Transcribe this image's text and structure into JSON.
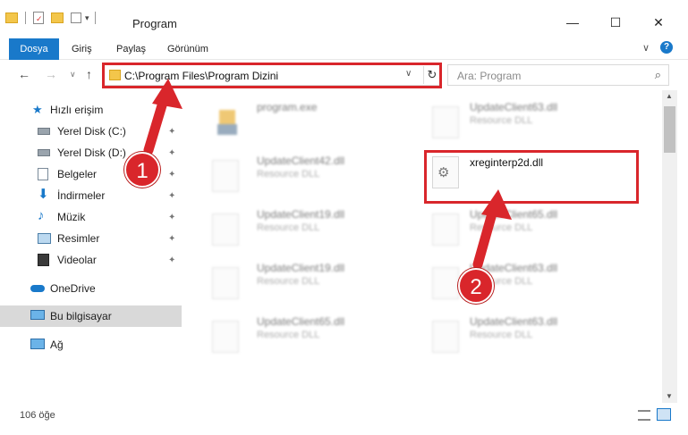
{
  "window": {
    "title": "Program",
    "minimize": "—",
    "maximize": "☐",
    "close": "✕"
  },
  "ribbon": {
    "tabs": [
      "Dosya",
      "Giriş",
      "Paylaş",
      "Görünüm"
    ],
    "expand": "∨",
    "help": "?"
  },
  "nav": {
    "back": "←",
    "forward": "→",
    "up_dropdown": "∨",
    "up": "↑",
    "address": "C:\\Program Files\\Program Dizini",
    "address_dropdown": "∨",
    "refresh": "↻",
    "search_placeholder": "Ara: Program",
    "search_icon": "⌕"
  },
  "sidebar": {
    "items": [
      {
        "label": "Hızlı erişim",
        "icon": "star-icon"
      },
      {
        "label": "Yerel Disk (C:)",
        "icon": "drive-icon",
        "pinned": true
      },
      {
        "label": "Yerel Disk (D:)",
        "icon": "drive-icon",
        "pinned": true
      },
      {
        "label": "Belgeler",
        "icon": "documents-icon",
        "pinned": true
      },
      {
        "label": "İndirmeler",
        "icon": "download-icon",
        "pinned": true
      },
      {
        "label": "Müzik",
        "icon": "music-icon",
        "pinned": true
      },
      {
        "label": "Resimler",
        "icon": "pictures-icon",
        "pinned": true
      },
      {
        "label": "Videolar",
        "icon": "video-icon",
        "pinned": true
      },
      {
        "label": "OneDrive",
        "icon": "cloud-icon"
      },
      {
        "label": "Bu bilgisayar",
        "icon": "computer-icon",
        "selected": true
      },
      {
        "label": "Ağ",
        "icon": "network-icon"
      }
    ],
    "pin_glyph": "📌"
  },
  "files": {
    "col1": [
      {
        "name": "program.exe",
        "desc": ""
      },
      {
        "name": "UpdateClient42.dll",
        "desc": "Resource DLL"
      },
      {
        "name": "UpdateClient19.dll",
        "desc": "Resource DLL"
      },
      {
        "name": "UpdateClient19.dll",
        "desc": "Resource DLL"
      },
      {
        "name": "UpdateClient65.dll",
        "desc": "Resource DLL"
      }
    ],
    "col2": [
      {
        "name": "UpdateClient63.dll",
        "desc": "Resource DLL"
      },
      {
        "name": "xreginterp2d.dll",
        "desc": "",
        "highlighted": true
      },
      {
        "name": "UpdateClient65.dll",
        "desc": "Resource DLL"
      },
      {
        "name": "UpdateClient63.dll",
        "desc": "Resource DLL"
      },
      {
        "name": "UpdateClient63.dll",
        "desc": "Resource DLL"
      }
    ]
  },
  "status": {
    "count": "106 öğe"
  },
  "callouts": [
    {
      "number": "1"
    },
    {
      "number": "2"
    }
  ],
  "colors": {
    "accent": "#1979ca",
    "highlight": "#d9262b"
  }
}
